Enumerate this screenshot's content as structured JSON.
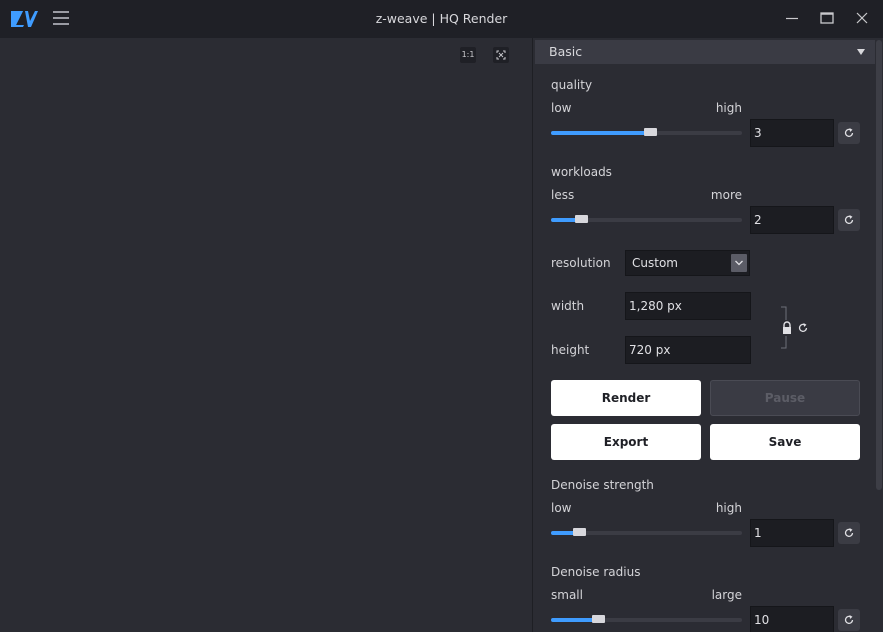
{
  "window": {
    "title": "z-weave | HQ Render"
  },
  "viewport": {
    "btn_actual_size": "1:1",
    "btn_fit": "⛶"
  },
  "panel": {
    "section_title": "Basic",
    "quality": {
      "label": "quality",
      "min_label": "low",
      "max_label": "high",
      "value": "3",
      "level": 0.5
    },
    "workloads": {
      "label": "workloads",
      "min_label": "less",
      "max_label": "more",
      "value": "2",
      "level": 0.14
    },
    "resolution": {
      "label": "resolution",
      "selected": "Custom"
    },
    "width": {
      "label": "width",
      "value": "1,280 px"
    },
    "height": {
      "label": "height",
      "value": "720 px"
    },
    "buttons": {
      "render": "Render",
      "pause": "Pause",
      "export": "Export",
      "save": "Save"
    },
    "denoise_strength": {
      "label": "Denoise strength",
      "min_label": "low",
      "max_label": "high",
      "value": "1",
      "level": 0.13
    },
    "denoise_radius": {
      "label": "Denoise radius",
      "min_label": "small",
      "max_label": "large",
      "value": "10",
      "level": 0.23
    }
  },
  "colors": {
    "accent": "#3f9cff",
    "title_bar": "#1f2026",
    "background": "#2b2c33"
  },
  "icons": {
    "logo": "zw-logo",
    "menu": "hamburger-icon",
    "minimize": "minimize-icon",
    "maximize": "maximize-icon",
    "close": "close-icon",
    "reset": "reset-icon",
    "lock": "lock-icon"
  }
}
